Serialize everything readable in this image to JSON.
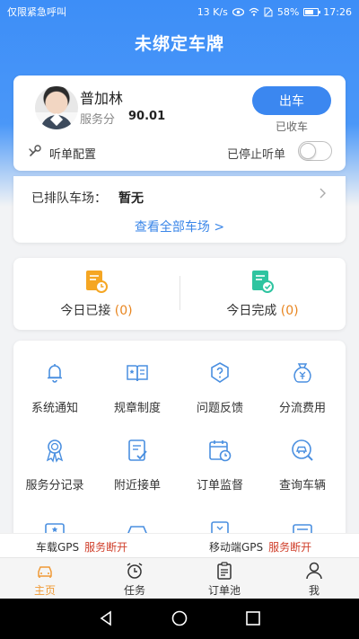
{
  "status_bar": {
    "carrier": "仅限紧急呼叫",
    "speed": "13 K/s",
    "battery": "58%",
    "time": "17:26"
  },
  "header": {
    "title": "未绑定车牌"
  },
  "driver": {
    "name": "普加林",
    "score_label": "服务分",
    "score": "90.01",
    "depart_button": "出车",
    "depart_status": "已收车",
    "config_label": "听单配置",
    "listen_status": "已停止听单",
    "listen_enabled": false
  },
  "queue": {
    "label": "已排队车场：",
    "value": "暂无",
    "view_all": "查看全部车场 >"
  },
  "today": {
    "accepted_label": "今日已接",
    "accepted_count": "(0)",
    "completed_label": "今日完成",
    "completed_count": "(0)"
  },
  "features": [
    {
      "label": "系统通知",
      "icon": "bell-icon"
    },
    {
      "label": "规章制度",
      "icon": "book-icon"
    },
    {
      "label": "问题反馈",
      "icon": "question-icon"
    },
    {
      "label": "分流费用",
      "icon": "money-bag-icon"
    },
    {
      "label": "服务分记录",
      "icon": "medal-icon"
    },
    {
      "label": "附近接单",
      "icon": "checklist-icon"
    },
    {
      "label": "订单监督",
      "icon": "calendar-clock-icon"
    },
    {
      "label": "查询车辆",
      "icon": "car-search-icon"
    }
  ],
  "gps": {
    "vehicle_name": "车载GPS",
    "vehicle_status": "服务断开",
    "mobile_name": "移动端GPS",
    "mobile_status": "服务断开"
  },
  "tabs": [
    {
      "label": "主页",
      "icon": "car-icon",
      "active": true
    },
    {
      "label": "任务",
      "icon": "alarm-clock-icon",
      "active": false
    },
    {
      "label": "订单池",
      "icon": "clipboard-icon",
      "active": false
    },
    {
      "label": "我",
      "icon": "person-icon",
      "active": false
    }
  ],
  "colors": {
    "primary": "#3b87f0",
    "accent_orange": "#e8851f",
    "warning_red": "#d0402c",
    "active_tab": "#f09a36"
  }
}
